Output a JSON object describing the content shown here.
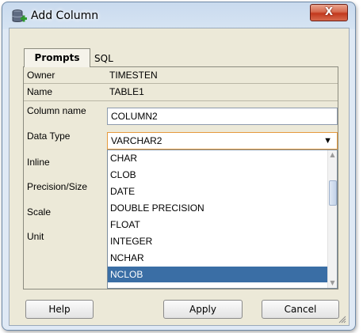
{
  "window": {
    "title": "Add Column",
    "close_glyph": "X",
    "icon": "database-add-icon"
  },
  "tabs": [
    {
      "label": "Prompts",
      "selected": true
    },
    {
      "label": "SQL",
      "selected": false
    }
  ],
  "fields": {
    "owner": {
      "label": "Owner",
      "value": "TIMESTEN"
    },
    "name": {
      "label": "Name",
      "value": "TABLE1"
    },
    "column_name": {
      "label": "Column name",
      "value": "COLUMN2"
    },
    "data_type": {
      "label": "Data Type",
      "value": "VARCHAR2"
    },
    "inline": {
      "label": "Inline"
    },
    "precision_size": {
      "label": "Precision/Size"
    },
    "scale": {
      "label": "Scale"
    },
    "unit": {
      "label": "Unit"
    }
  },
  "dropdown": {
    "options": [
      "CHAR",
      "CLOB",
      "DATE",
      "DOUBLE PRECISION",
      "FLOAT",
      "INTEGER",
      "NCHAR",
      "NCLOB"
    ],
    "highlighted": "NCLOB"
  },
  "buttons": {
    "help": "Help",
    "apply": "Apply",
    "cancel": "Cancel"
  },
  "colors": {
    "selection": "#3a6ea5",
    "combo_focus_border": "#e59a3d",
    "close_button": "#c2381d"
  }
}
